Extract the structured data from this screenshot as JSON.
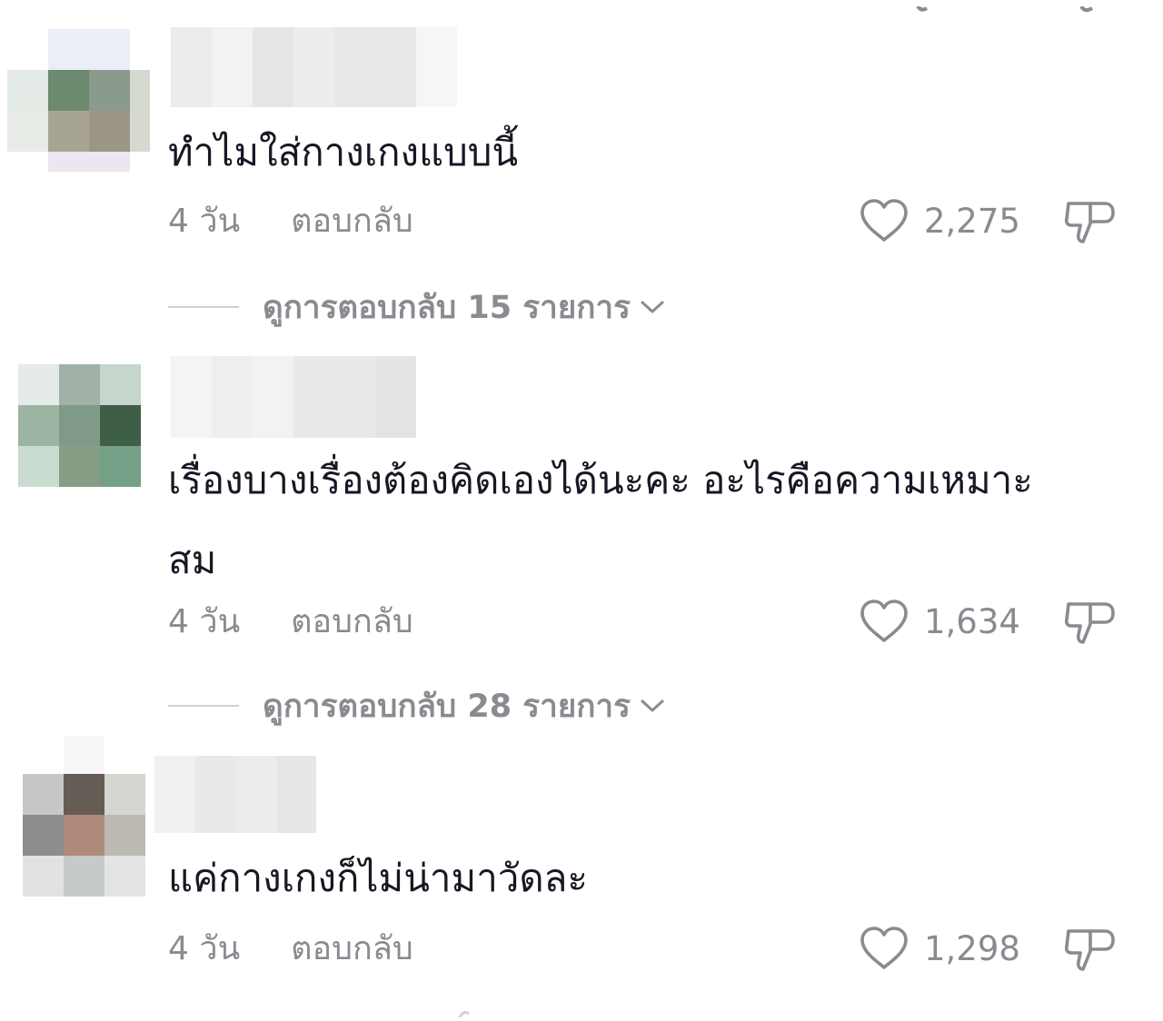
{
  "comments": [
    {
      "text": "ทำไมใส่กางเกงแบบนี้",
      "time": "4 วัน",
      "reply_label": "ตอบกลับ",
      "likes": "2,275",
      "view_replies": "ดูการตอบกลับ 15 รายการ"
    },
    {
      "text": "เรื่องบางเรื่องต้องคิดเองได้นะคะ อะไรคือความเหมาะ\nสม",
      "time": "4 วัน",
      "reply_label": "ตอบกลับ",
      "likes": "1,634",
      "view_replies": "ดูการตอบกลับ 28 รายการ"
    },
    {
      "text": "แค่กางเกงก็ไม่น่ามาวัดละ",
      "time": "4 วัน",
      "reply_label": "ตอบกลับ",
      "likes": "1,298"
    }
  ],
  "icons": {
    "like": "heart-outline-icon",
    "dislike": "thumbs-down-icon",
    "expand": "chevron-down-icon"
  },
  "colors": {
    "text_primary": "#161823",
    "text_secondary": "#8a8b91",
    "divider": "#cfd0d3"
  }
}
